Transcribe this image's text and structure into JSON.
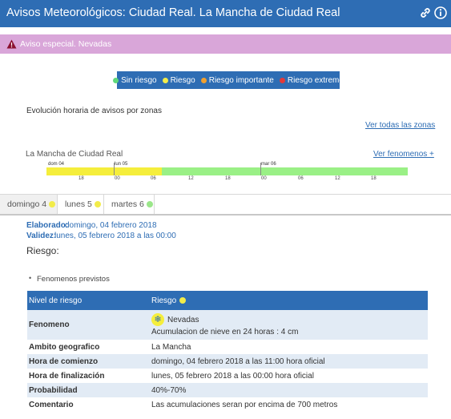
{
  "header": {
    "title": "Avisos Meteorológicos: Ciudad Real. La Mancha de Ciudad Real",
    "link_icon": "link-icon",
    "info_icon": "info-icon"
  },
  "banner": {
    "text": "Aviso especial. Nevadas",
    "color": "#d9a6d9",
    "icon": "warning-icon"
  },
  "legend": {
    "items": [
      {
        "label": "Sin riesgo",
        "color": "#5fd87a"
      },
      {
        "label": "Riesgo",
        "color": "#f2ec4a"
      },
      {
        "label": "Riesgo importante",
        "color": "#f0a030"
      },
      {
        "label": "Riesgo extremo",
        "color": "#e23a3a"
      }
    ]
  },
  "evolution": {
    "title": "Evolución horaria de avisos por zonas",
    "see_all": "Ver todas las zonas"
  },
  "zone": {
    "name": "La Mancha de Ciudad Real",
    "see_phenomena": "Ver fenomenos +",
    "day_labels": [
      "dom 04",
      "lun 05",
      "mar 06"
    ],
    "ticks": [
      "18",
      "00",
      "06",
      "12",
      "18",
      "00",
      "06",
      "12",
      "18"
    ],
    "risk_color": "#f5ee3c",
    "safe_color": "#9af086"
  },
  "tabs": [
    {
      "label": "domingo 4",
      "color": "#f2ec4a"
    },
    {
      "label": "lunes 5",
      "color": "#f2ec4a"
    },
    {
      "label": "martes 6",
      "color": "#9be68a"
    }
  ],
  "details": {
    "elaborado_label": "Elaborado:",
    "elaborado_value": "domingo, 04 febrero 2018",
    "validez_label": "Validez:",
    "validez_value": "lunes, 05 febrero 2018 a las 00:00",
    "riesgo": "Riesgo:",
    "fenomenos": "Fenomenos previstos"
  },
  "table": {
    "col1": "Nivel de riesgo",
    "col2": "Riesgo",
    "col2_color": "#f2ec4a",
    "fenomeno_label": "Fenomeno",
    "fenomeno_name": "Nevadas",
    "fenomeno_icon": "snowflake-icon",
    "fenomeno_desc": "Acumulacion de nieve en 24 horas : 4 cm",
    "rows": [
      {
        "k": "Ambito geografico",
        "v": "La Mancha"
      },
      {
        "k": "Hora de comienzo",
        "v": "domingo, 04 febrero 2018 a las 11:00 hora oficial"
      },
      {
        "k": "Hora de finalización",
        "v": "lunes, 05 febrero 2018 a las 00:00 hora oficial"
      },
      {
        "k": "Probabilidad",
        "v": "40%-70%"
      },
      {
        "k": "Comentario",
        "v": "Las acumulaciones seran por encima de 700 metros"
      }
    ]
  }
}
